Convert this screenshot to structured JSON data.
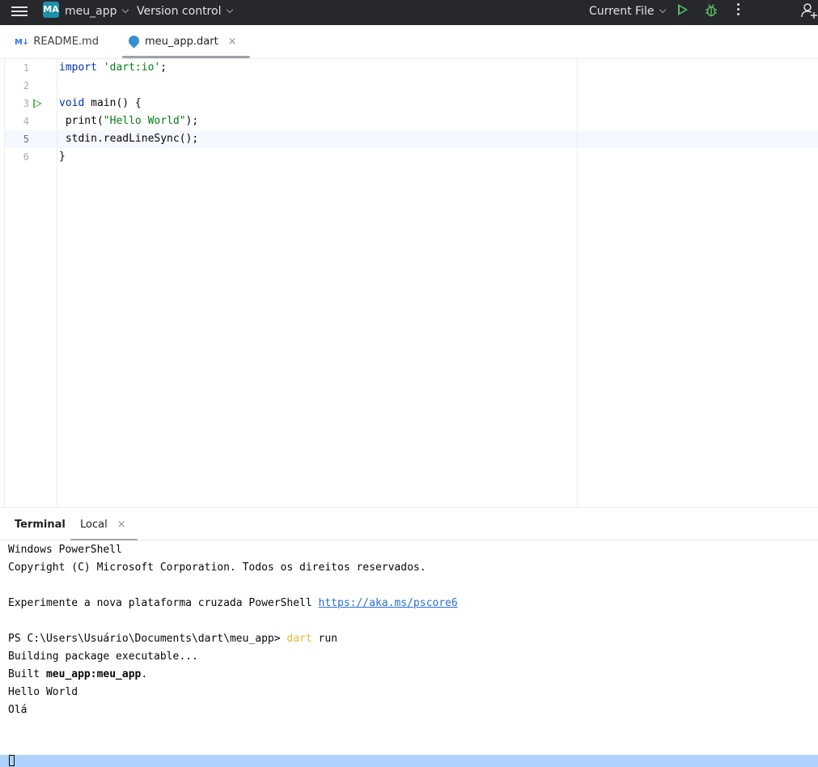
{
  "titlebar": {
    "project_badge": "MA",
    "project_name": "meu_app",
    "vcs": "Version control",
    "run_config": "Current File"
  },
  "tabs": [
    {
      "icon": "M↓",
      "label": "README.md"
    },
    {
      "label": "meu_app.dart",
      "close": "×"
    }
  ],
  "editor": {
    "lines": [
      "1",
      "2",
      "3",
      "4",
      "5",
      "6"
    ],
    "code": {
      "l1_kw": "import",
      "l1_str": "'dart:io'",
      "l1_end": ";",
      "l3_kw": "void",
      "l3_rest": " main() {",
      "l4_a": " print(",
      "l4_str": "\"Hello World\"",
      "l4_b": ");",
      "l5": " stdin.readLineSync();",
      "l6": "}"
    }
  },
  "terminal": {
    "title": "Terminal",
    "tab": "Local",
    "tab_close": "×",
    "lines": {
      "l1": "Windows PowerShell",
      "l2": "Copyright (C) Microsoft Corporation. Todos os direitos reservados.",
      "l4_text": "Experimente a nova plataforma cruzada PowerShell ",
      "l4_link": "https://aka.ms/pscore6",
      "l6_prompt": "PS C:\\Users\\Usuário\\Documents\\dart\\meu_app> ",
      "l6_cmd": "dart",
      "l6_arg": " run",
      "l7": "Building package executable...",
      "l8_pre": "Built ",
      "l8_bold": "meu_app:meu_app",
      "l8_post": ".",
      "l9": "Hello World",
      "l10": "Olá"
    }
  }
}
